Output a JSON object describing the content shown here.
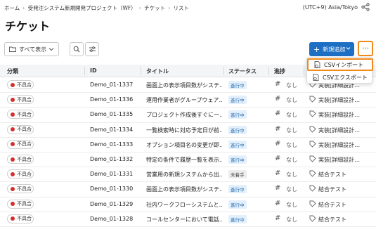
{
  "breadcrumb": [
    "ホーム",
    "受発注システム新規開発プロジェクト（WF）",
    "チケット",
    "リスト"
  ],
  "timezone": "(UTC+9) Asia/Tokyo",
  "page_title": "チケット",
  "toolbar": {
    "view_label": "すべて表示",
    "add_label": "新規追加",
    "more_label": "···"
  },
  "menu": {
    "import_label": "CSVインポート",
    "export_label": "CSVエクスポート"
  },
  "columns": [
    "分類",
    "ID",
    "タイトル",
    "ステータス",
    "進捗",
    ""
  ],
  "colors": {
    "accent": "#1d6fc4",
    "highlight": "#f08a1c",
    "in_progress_bg": "#e3f0fc",
    "in_progress_fg": "#2b6cb0",
    "not_started_bg": "#ededed",
    "not_started_fg": "#444444",
    "bug_dot": "#d32f2f"
  },
  "rows": [
    {
      "category": "不具合",
      "id": "Demo_01-1337",
      "title": "画面上の表示項目数がシステ…",
      "status": "進行中",
      "progress": "なし",
      "label": "実装[詳細設計…"
    },
    {
      "category": "不具合",
      "id": "Demo_01-1336",
      "title": "運用作業者がグループウェア…",
      "status": "進行中",
      "progress": "なし",
      "label": "実装[詳細設計…"
    },
    {
      "category": "不具合",
      "id": "Demo_01-1335",
      "title": "プロジェクト作成後すぐに一…",
      "status": "進行中",
      "progress": "なし",
      "label": "実装[詳細設計…"
    },
    {
      "category": "不具合",
      "id": "Demo_01-1334",
      "title": "一覧検索時に対応予定日が前…",
      "status": "進行中",
      "progress": "なし",
      "label": "実装[詳細設計…"
    },
    {
      "category": "不具合",
      "id": "Demo_01-1333",
      "title": "オプション項目名の変更が即…",
      "status": "進行中",
      "progress": "なし",
      "label": "実装[詳細設計…"
    },
    {
      "category": "不具合",
      "id": "Demo_01-1332",
      "title": "特定の条件で履歴一覧を表示…",
      "status": "進行中",
      "progress": "なし",
      "label": "実装[詳細設計…"
    },
    {
      "category": "不具合",
      "id": "Demo_01-1331",
      "title": "営業用の新規システムから出…",
      "status": "未着手",
      "progress": "なし",
      "label": "結合テスト"
    },
    {
      "category": "不具合",
      "id": "Demo_01-1330",
      "title": "画面上の表示項目数がシステ…",
      "status": "進行中",
      "progress": "なし",
      "label": "結合テスト"
    },
    {
      "category": "不具合",
      "id": "Demo_01-1329",
      "title": "社内ワークフローシステムと…",
      "status": "進行中",
      "progress": "なし",
      "label": "結合テスト"
    },
    {
      "category": "不具合",
      "id": "Demo_01-1328",
      "title": "コールセンターにおいて電話…",
      "status": "進行中",
      "progress": "なし",
      "label": "結合テスト"
    }
  ]
}
